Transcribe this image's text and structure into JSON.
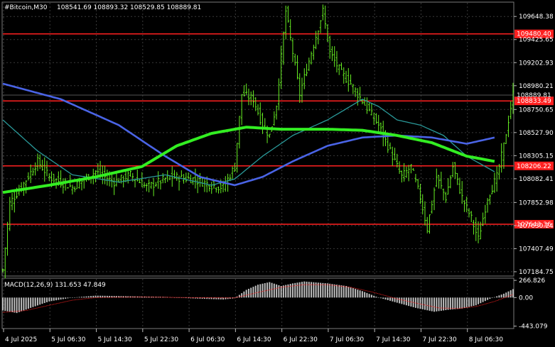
{
  "header": {
    "symbol": "#Bitcoin,M30",
    "ohlc": "108541.69 108893.32 108529.85 108889.81"
  },
  "chart_data": [
    {
      "type": "candlestick",
      "title": "#Bitcoin,M30",
      "x_ticks": [
        "4 Jul 2025",
        "5 Jul 06:30",
        "5 Jul 14:30",
        "5 Jul 22:30",
        "6 Jul 06:30",
        "6 Jul 14:30",
        "6 Jul 22:30",
        "7 Jul 06:30",
        "7 Jul 14:30",
        "7 Jul 22:30",
        "8 Jul 06:30"
      ],
      "y_ticks": [
        109648.38,
        109425.65,
        109202.93,
        108980.21,
        108750.65,
        108527.9,
        108305.15,
        108082.41,
        107852.98,
        107630.24,
        107407.49,
        107184.75
      ],
      "ylim": [
        107150,
        109780
      ],
      "current_price_label": "108889.81",
      "levels": [
        {
          "label": "109480.40",
          "value": 109480.4,
          "color": "#ff2020"
        },
        {
          "label": "108833.49",
          "value": 108833.49,
          "color": "#ff2020"
        },
        {
          "label": "108206.22",
          "value": 108206.22,
          "color": "#ff2020"
        },
        {
          "label": "107643.36",
          "value": 107643.36,
          "color": "#ff2020"
        }
      ],
      "candle_color": "#66ee22",
      "ma_colors": {
        "teal": "#2a9a9a",
        "blue": "#4a64e6",
        "green": "#33ee22"
      },
      "price_anchors": [
        [
          0,
          107200
        ],
        [
          3,
          107850
        ],
        [
          8,
          108000
        ],
        [
          15,
          108250
        ],
        [
          20,
          108100
        ],
        [
          30,
          108000
        ],
        [
          40,
          108150
        ],
        [
          48,
          108050
        ],
        [
          55,
          108120
        ],
        [
          62,
          108000
        ],
        [
          72,
          108100
        ],
        [
          82,
          108080
        ],
        [
          90,
          108020
        ],
        [
          95,
          108000
        ],
        [
          100,
          108200
        ],
        [
          103,
          108900
        ],
        [
          108,
          108850
        ],
        [
          112,
          108600
        ],
        [
          115,
          108500
        ],
        [
          118,
          108800
        ],
        [
          122,
          109700
        ],
        [
          128,
          108900
        ],
        [
          133,
          109300
        ],
        [
          138,
          109700
        ],
        [
          141,
          109300
        ],
        [
          146,
          109100
        ],
        [
          150,
          109000
        ],
        [
          156,
          108800
        ],
        [
          162,
          108600
        ],
        [
          168,
          108300
        ],
        [
          172,
          108100
        ],
        [
          176,
          108200
        ],
        [
          180,
          107900
        ],
        [
          183,
          107600
        ],
        [
          187,
          108100
        ],
        [
          191,
          107900
        ],
        [
          194,
          108200
        ],
        [
          198,
          107900
        ],
        [
          202,
          107700
        ],
        [
          205,
          107500
        ],
        [
          209,
          107900
        ],
        [
          213,
          108100
        ],
        [
          216,
          108400
        ],
        [
          220,
          108900
        ]
      ],
      "ma_teal_anchors": [
        [
          0,
          108650
        ],
        [
          15,
          108350
        ],
        [
          30,
          108120
        ],
        [
          50,
          108050
        ],
        [
          70,
          108120
        ],
        [
          90,
          108020
        ],
        [
          100,
          108080
        ],
        [
          112,
          108300
        ],
        [
          125,
          108500
        ],
        [
          140,
          108650
        ],
        [
          155,
          108850
        ],
        [
          162,
          108780
        ],
        [
          170,
          108650
        ],
        [
          180,
          108600
        ],
        [
          190,
          108500
        ],
        [
          200,
          108300
        ],
        [
          212,
          108150
        ]
      ],
      "ma_blue_anchors": [
        [
          0,
          109000
        ],
        [
          25,
          108850
        ],
        [
          50,
          108600
        ],
        [
          70,
          108300
        ],
        [
          85,
          108100
        ],
        [
          100,
          108020
        ],
        [
          112,
          108100
        ],
        [
          125,
          108250
        ],
        [
          140,
          108400
        ],
        [
          155,
          108480
        ],
        [
          170,
          108500
        ],
        [
          185,
          108480
        ],
        [
          200,
          108420
        ],
        [
          212,
          108480
        ]
      ],
      "ma_green_anchors": [
        [
          0,
          107950
        ],
        [
          20,
          108020
        ],
        [
          40,
          108100
        ],
        [
          60,
          108200
        ],
        [
          75,
          108400
        ],
        [
          90,
          108520
        ],
        [
          105,
          108580
        ],
        [
          120,
          108560
        ],
        [
          140,
          108560
        ],
        [
          155,
          108550
        ],
        [
          170,
          108500
        ],
        [
          185,
          108430
        ],
        [
          200,
          108300
        ],
        [
          212,
          108250
        ]
      ]
    },
    {
      "type": "histogram",
      "title": "MACD(12,26,9) 131.653 47.849",
      "y_ticks": [
        266.826,
        0.0,
        -443.079
      ],
      "ylim": [
        -470,
        290
      ],
      "bar_color": "#bdbdbd",
      "signal_color": "#ff2020",
      "macd_anchors": [
        [
          0,
          -200
        ],
        [
          6,
          -240
        ],
        [
          12,
          -160
        ],
        [
          20,
          -60
        ],
        [
          30,
          0
        ],
        [
          40,
          30
        ],
        [
          55,
          20
        ],
        [
          70,
          10
        ],
        [
          80,
          -10
        ],
        [
          95,
          -30
        ],
        [
          100,
          -10
        ],
        [
          105,
          120
        ],
        [
          110,
          200
        ],
        [
          115,
          240
        ],
        [
          120,
          180
        ],
        [
          125,
          220
        ],
        [
          130,
          250
        ],
        [
          140,
          220
        ],
        [
          148,
          180
        ],
        [
          155,
          100
        ],
        [
          162,
          0
        ],
        [
          170,
          -80
        ],
        [
          178,
          -160
        ],
        [
          186,
          -220
        ],
        [
          192,
          -190
        ],
        [
          198,
          -170
        ],
        [
          204,
          -120
        ],
        [
          210,
          -20
        ],
        [
          216,
          60
        ],
        [
          220,
          131
        ]
      ],
      "signal_anchors": [
        [
          0,
          -230
        ],
        [
          10,
          -200
        ],
        [
          20,
          -120
        ],
        [
          30,
          -40
        ],
        [
          40,
          0
        ],
        [
          60,
          10
        ],
        [
          80,
          0
        ],
        [
          100,
          -5
        ],
        [
          110,
          80
        ],
        [
          120,
          160
        ],
        [
          130,
          200
        ],
        [
          140,
          200
        ],
        [
          150,
          160
        ],
        [
          160,
          80
        ],
        [
          170,
          -20
        ],
        [
          180,
          -100
        ],
        [
          188,
          -160
        ],
        [
          196,
          -170
        ],
        [
          204,
          -140
        ],
        [
          212,
          -60
        ],
        [
          220,
          47.849
        ]
      ]
    }
  ]
}
